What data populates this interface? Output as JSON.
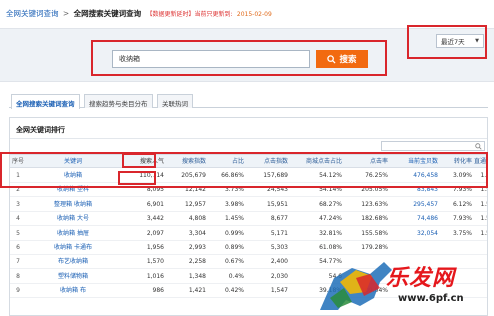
{
  "breadcrumb": {
    "root": "全网关键词查询",
    "separator": ">",
    "current": "全网搜索关键词查询",
    "update_note": "【数据更新延时】当前只更新到:",
    "update_date": "2015-02-09"
  },
  "search": {
    "value": "收纳箱",
    "button_label": "搜索"
  },
  "range_select": {
    "value": "最近7天"
  },
  "tabs": [
    {
      "label": "全网搜索关键词查询"
    },
    {
      "label": "搜索趋势与类目分布"
    },
    {
      "label": "关联热词"
    }
  ],
  "panel": {
    "title": "全网关键词排行"
  },
  "table": {
    "columns": [
      "序号",
      "关键词",
      "搜索人气",
      "搜索指数",
      "占比",
      "点击指数",
      "商城点击占比",
      "点击率",
      "当前宝贝数",
      "转化率",
      "直通车"
    ],
    "rows": [
      {
        "idx": "1",
        "kw": "收纳箱",
        "pop": "110,714",
        "sidx": "205,679",
        "share": "66.86%",
        "cidx": "157,689",
        "mall": "54.12%",
        "ctr": "76.25%",
        "sku": "476,458",
        "conv": "3.09%",
        "train": "1.5"
      },
      {
        "idx": "2",
        "kw": "收纳箱 塑料",
        "pop": "8,095",
        "sidx": "12,142",
        "share": "3.73%",
        "cidx": "24,543",
        "mall": "54.14%",
        "ctr": "205.05%",
        "sku": "83,843",
        "conv": "7.93%",
        "train": "1.5"
      },
      {
        "idx": "3",
        "kw": "整理箱 收纳箱",
        "pop": "6,901",
        "sidx": "12,957",
        "share": "3.98%",
        "cidx": "15,951",
        "mall": "68.27%",
        "ctr": "123.63%",
        "sku": "295,457",
        "conv": "6.12%",
        "train": "1.5"
      },
      {
        "idx": "4",
        "kw": "收纳箱 大号",
        "pop": "3,442",
        "sidx": "4,808",
        "share": "1.45%",
        "cidx": "8,677",
        "mall": "47.24%",
        "ctr": "182.68%",
        "sku": "74,486",
        "conv": "7.93%",
        "train": "1.5"
      },
      {
        "idx": "5",
        "kw": "收纳箱 抽屉",
        "pop": "2,097",
        "sidx": "3,304",
        "share": "0.99%",
        "cidx": "5,171",
        "mall": "32.81%",
        "ctr": "155.58%",
        "sku": "32,054",
        "conv": "3.75%",
        "train": "1.5"
      },
      {
        "idx": "6",
        "kw": "收纳箱 卡通布",
        "pop": "1,956",
        "sidx": "2,993",
        "share": "0.89%",
        "cidx": "5,303",
        "mall": "61.08%",
        "ctr": "179.28%",
        "sku": "",
        "conv": "",
        "train": ""
      },
      {
        "idx": "7",
        "kw": "布艺收纳箱",
        "pop": "1,570",
        "sidx": "2,258",
        "share": "0.67%",
        "cidx": "2,400",
        "mall": "54.77%",
        "ctr": "",
        "sku": "",
        "conv": "",
        "train": ""
      },
      {
        "idx": "8",
        "kw": "塑料储物箱",
        "pop": "1,016",
        "sidx": "1,348",
        "share": "0.4%",
        "cidx": "2,030",
        "mall": "54.6",
        "ctr": "",
        "sku": "",
        "conv": "",
        "train": ""
      },
      {
        "idx": "9",
        "kw": "收纳箱 布",
        "pop": "986",
        "sidx": "1,421",
        "share": "0.42%",
        "cidx": "1,547",
        "mall": "39.18%",
        "ctr": "109.04%",
        "sku": "",
        "conv": "",
        "train": ""
      }
    ]
  },
  "watermark": {
    "logo_text": "乐发网",
    "site": "www.6pf.cn"
  },
  "colors": {
    "highlight_red": "#d9262c",
    "button_orange": "#f26a10",
    "link_blue": "#1a5fb4"
  }
}
